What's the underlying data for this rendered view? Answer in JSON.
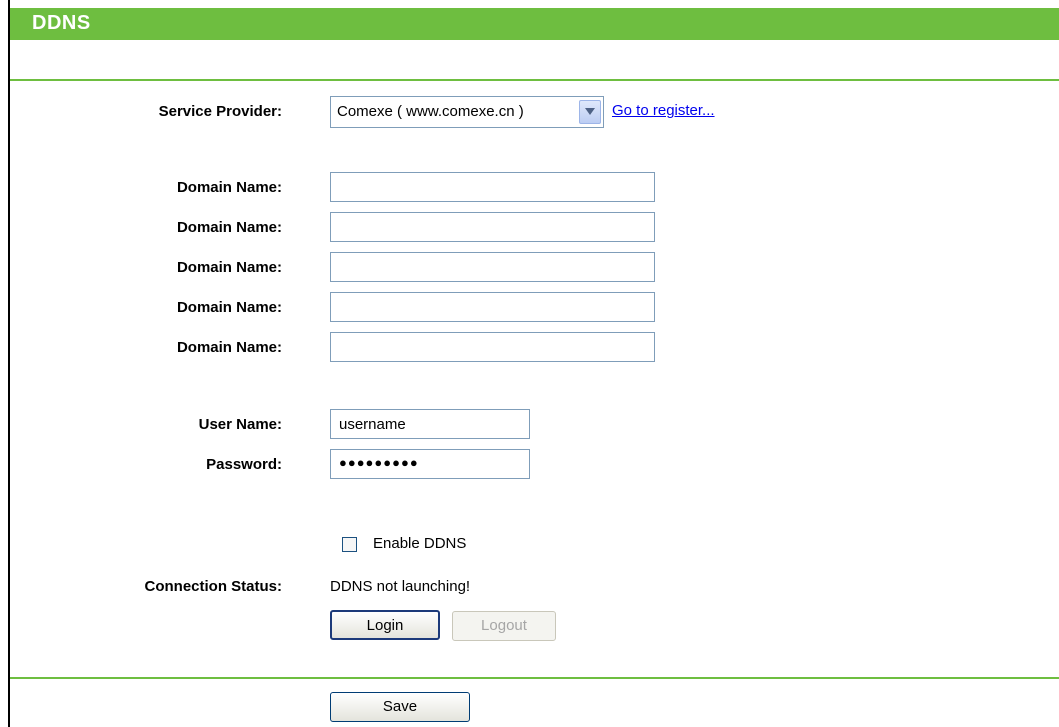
{
  "header": {
    "title": "DDNS"
  },
  "form": {
    "service_provider_label": "Service Provider:",
    "service_provider_value": "Comexe ( www.comexe.cn )",
    "register_link": "Go to register...",
    "domain_label": "Domain Name:",
    "domains": [
      "",
      "",
      "",
      "",
      ""
    ],
    "username_label": "User Name:",
    "username_value": "username",
    "password_label": "Password:",
    "password_display": "●●●●●●●●●",
    "enable_label": "Enable DDNS",
    "enable_checked": false,
    "connection_status_label": "Connection Status:",
    "connection_status_value": "DDNS not launching!",
    "login_label": "Login",
    "logout_label": "Logout",
    "save_label": "Save"
  },
  "colors": {
    "accent": "#6ebe40",
    "link": "#0000ee"
  }
}
